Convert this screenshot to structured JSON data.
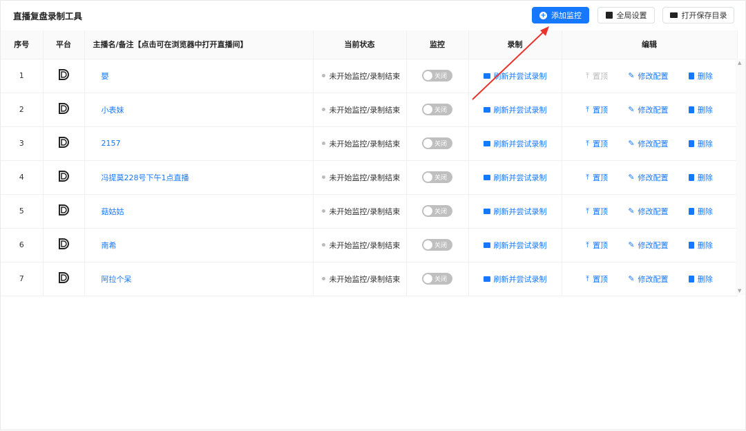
{
  "app": {
    "title": "直播复盘录制工具"
  },
  "toolbar": {
    "add_label": "添加监控",
    "settings_label": "全局设置",
    "open_dir_label": "打开保存目录"
  },
  "columns": [
    "序号",
    "平台",
    "主播名/备注【点击可在浏览器中打开直播间】",
    "当前状态",
    "监控",
    "录制",
    "编辑"
  ],
  "rows": [
    {
      "index": "1",
      "name": "嬰",
      "status": "未开始监控/录制结束",
      "monitor": "关闭",
      "record": "刷新并尝试录制",
      "pin": "置顶",
      "pin_disabled": true,
      "edit": "修改配置",
      "delete": "删除"
    },
    {
      "index": "2",
      "name": "小表妹",
      "status": "未开始监控/录制结束",
      "monitor": "关闭",
      "record": "刷新并尝试录制",
      "pin": "置顶",
      "pin_disabled": false,
      "edit": "修改配置",
      "delete": "删除"
    },
    {
      "index": "3",
      "name": "2157",
      "status": "未开始监控/录制结束",
      "monitor": "关闭",
      "record": "刷新并尝试录制",
      "pin": "置顶",
      "pin_disabled": false,
      "edit": "修改配置",
      "delete": "删除"
    },
    {
      "index": "4",
      "name": "冯提莫228号下午1点直播",
      "status": "未开始监控/录制结束",
      "monitor": "关闭",
      "record": "刷新并尝试录制",
      "pin": "置顶",
      "pin_disabled": false,
      "edit": "修改配置",
      "delete": "删除"
    },
    {
      "index": "5",
      "name": "菇姑姑",
      "status": "未开始监控/录制结束",
      "monitor": "关闭",
      "record": "刷新并尝试录制",
      "pin": "置顶",
      "pin_disabled": false,
      "edit": "修改配置",
      "delete": "删除"
    },
    {
      "index": "6",
      "name": "南希",
      "status": "未开始监控/录制结束",
      "monitor": "关闭",
      "record": "刷新并尝试录制",
      "pin": "置顶",
      "pin_disabled": false,
      "edit": "修改配置",
      "delete": "删除"
    },
    {
      "index": "7",
      "name": "阿拉个呆",
      "status": "未开始监控/录制结束",
      "monitor": "关闭",
      "record": "刷新并尝试录制",
      "pin": "置顶",
      "pin_disabled": false,
      "edit": "修改配置",
      "delete": "删除"
    }
  ],
  "colors": {
    "primary": "#1677ff",
    "annotation_arrow": "#e8322b"
  }
}
